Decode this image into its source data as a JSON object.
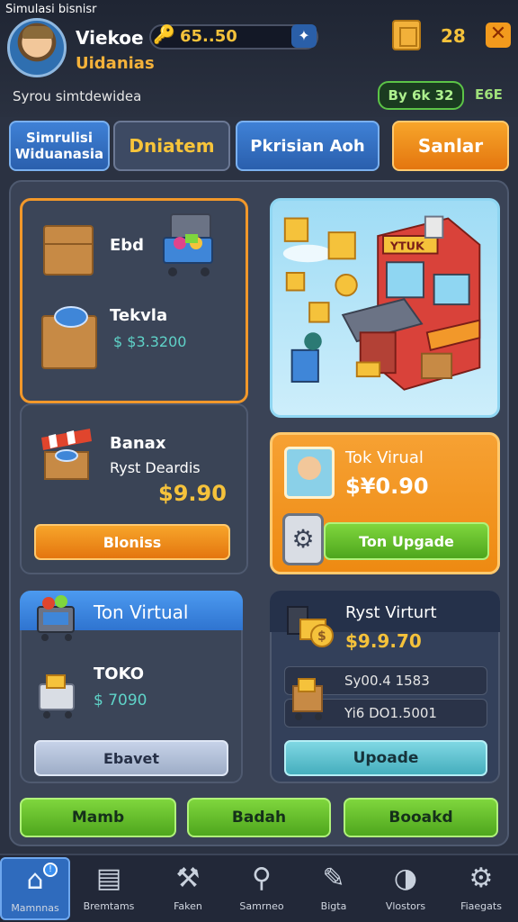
{
  "app_title": "Simulasi bisnisr",
  "player": {
    "name": "Viekoe",
    "subtitle": "Uidanias"
  },
  "currency": {
    "coins": "65..50",
    "gems": "28"
  },
  "status": {
    "text": "Syrou simtdewidea",
    "badge": "By 6k 32",
    "extra": "E6E"
  },
  "tabs": {
    "sim_line1": "Simrulisi",
    "sim_line2": "Widuanasia",
    "dn": "Dniatem",
    "pk": "Pkrisian Aoh",
    "sanlar": "Sanlar"
  },
  "inventory": {
    "label_1": "Ebd",
    "label_2": "Tekvla",
    "value_2": "$ $3.3200"
  },
  "market": {
    "title": "Banax",
    "subtitle": "Ryst Deardis",
    "price": "$9.90",
    "button": "Bloniss"
  },
  "shop": {
    "title": "Tok Virual",
    "price": "$¥0.90",
    "button": "Ton Upgade",
    "sign": "YTUK"
  },
  "toko": {
    "title": "Ton Virtual",
    "label": "TOKO",
    "value": "$ 7090",
    "button": "Ebavet"
  },
  "ryst": {
    "title": "Ryst Virturt",
    "price": "$9.9.70",
    "row_1": "Sy00.4 1583",
    "row_2": "Yi6 DO1.5001",
    "button": "Upoade"
  },
  "actions": {
    "btn_1": "Mamb",
    "btn_2": "Badah",
    "btn_3": "Booakd"
  },
  "nav": {
    "home": "Mamnnas",
    "stores": "Bremtams",
    "tools": "Faken",
    "search": "Samrneo",
    "docs": "Bigta",
    "visitors": "Vlostors",
    "settings": "Fiaegats"
  },
  "icons": {
    "coin": "coin-icon",
    "gem": "gem-icon",
    "close": "close-icon",
    "home": "home-icon",
    "store": "store-icon",
    "tools": "tools-icon",
    "search": "search-icon",
    "docs": "docs-icon",
    "visitors": "visitors-icon",
    "settings": "gear-icon"
  },
  "colors": {
    "accent_orange": "#f29a1d",
    "accent_green": "#5cc447",
    "accent_blue": "#2f74d0",
    "gold": "#f5c23b",
    "background": "#2b3242"
  }
}
